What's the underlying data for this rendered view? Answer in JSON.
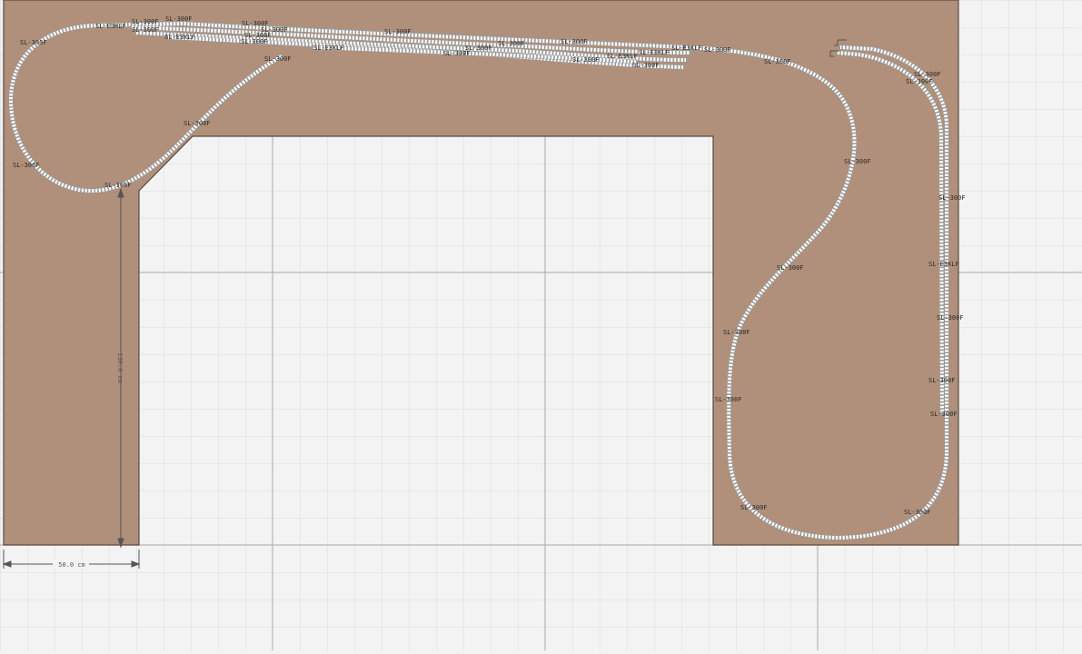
{
  "colors": {
    "background": "#f3f3f3",
    "grid_minor": "#dcdcdc",
    "grid_major": "#a9a9a9",
    "baseboard": "#b0907b",
    "baseboard_edge": "#5a4a40",
    "rail": "#9a9a9a",
    "sleeper": "#ffffff",
    "dimension": "#555555",
    "label": "#2a2a2a"
  },
  "dimensions": {
    "height_label": "130.0 cm",
    "width_label": "50.0 cm"
  },
  "track_part_labels": [
    "SL-300F",
    "SL-E3KLF",
    "SL-300F",
    "SL-300F",
    "SL-300F",
    "SL-E3KLF",
    "SL-300F",
    "SL-300F",
    "SL-300F",
    "SL-300F",
    "SL-300F",
    "SL-E3KLF",
    "SL-300F",
    "SL-300F",
    "SL-300F",
    "SL-300F",
    "SL-300F",
    "SL-300F",
    "SL-E3KLF",
    "SL-E3KLF",
    "SL-E3KLF",
    "SL-300F",
    "SL-300F",
    "SL-300F",
    "SL-300F",
    "SL-300F",
    "SL-300F",
    "SL-300F",
    "SL-300F",
    "SL-300F",
    "SL-300F",
    "SL-300F",
    "SL-E3KLF",
    "SL-300F",
    "SL-300F",
    "SL-300F",
    "SL-300F",
    "SL-300F",
    "SL-300F",
    "SL-300F"
  ]
}
